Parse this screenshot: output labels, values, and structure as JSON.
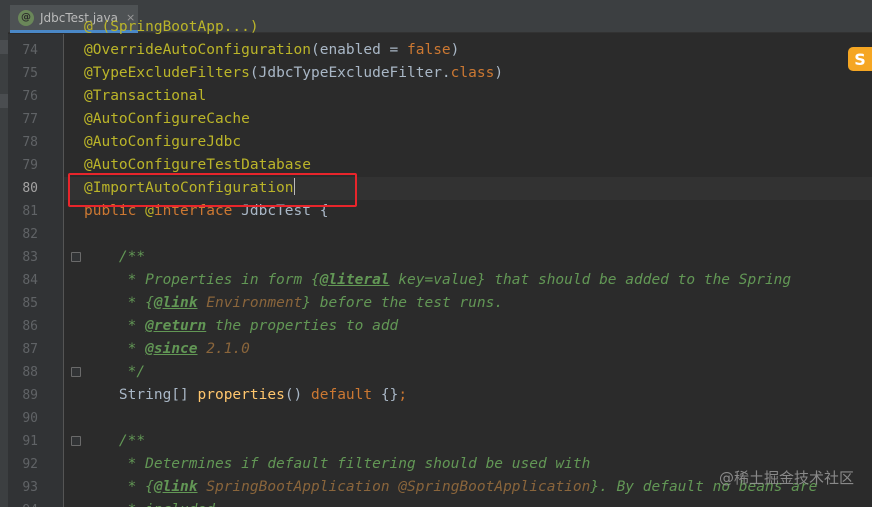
{
  "tab": {
    "icon_letter": "@",
    "label": "JdbcTest.java",
    "close": "×"
  },
  "top_partial": "@ (SpringBootApp...)",
  "lines": [
    {
      "n": "74",
      "tokens": [
        [
          "ann",
          "@OverrideAutoConfiguration"
        ],
        [
          "plain",
          "(enabled = "
        ],
        [
          "kw",
          "false"
        ],
        [
          "plain",
          ")"
        ]
      ]
    },
    {
      "n": "75",
      "tokens": [
        [
          "ann",
          "@TypeExcludeFilters"
        ],
        [
          "plain",
          "(JdbcTypeExcludeFilter."
        ],
        [
          "kw",
          "class"
        ],
        [
          "plain",
          ")"
        ]
      ]
    },
    {
      "n": "76",
      "tokens": [
        [
          "ann",
          "@Transactional"
        ]
      ]
    },
    {
      "n": "77",
      "tokens": [
        [
          "ann",
          "@AutoConfigureCache"
        ]
      ]
    },
    {
      "n": "78",
      "tokens": [
        [
          "ann",
          "@AutoConfigureJdbc"
        ]
      ]
    },
    {
      "n": "79",
      "tokens": [
        [
          "ann",
          "@AutoConfigureTestDatabase"
        ]
      ]
    },
    {
      "n": "80",
      "tokens": [
        [
          "ann",
          "@ImportAutoConfiguration"
        ]
      ],
      "current": true
    },
    {
      "n": "81",
      "tokens": [
        [
          "kw",
          "public "
        ],
        [
          "ann",
          "@"
        ],
        [
          "kw",
          "interface "
        ],
        [
          "plain",
          "JdbcTest {"
        ]
      ]
    },
    {
      "n": "82",
      "tokens": []
    },
    {
      "n": "83",
      "tokens": [
        [
          "plain",
          "    "
        ],
        [
          "doc",
          "/**"
        ]
      ],
      "fold": true
    },
    {
      "n": "84",
      "tokens": [
        [
          "plain",
          "     "
        ],
        [
          "doc",
          "* Properties in form {"
        ],
        [
          "doctag",
          "@literal"
        ],
        [
          "doc",
          " key=value} that should be added to the Spring"
        ]
      ]
    },
    {
      "n": "85",
      "tokens": [
        [
          "plain",
          "     "
        ],
        [
          "doc",
          "* {"
        ],
        [
          "doctag",
          "@link"
        ],
        [
          "docval",
          " Environment"
        ],
        [
          "doc",
          "} before the test runs."
        ]
      ]
    },
    {
      "n": "86",
      "tokens": [
        [
          "plain",
          "     "
        ],
        [
          "doc",
          "* "
        ],
        [
          "doctag",
          "@return"
        ],
        [
          "doc",
          " the properties to add"
        ]
      ]
    },
    {
      "n": "87",
      "tokens": [
        [
          "plain",
          "     "
        ],
        [
          "doc",
          "* "
        ],
        [
          "doctag",
          "@since"
        ],
        [
          "docval",
          " 2.1.0"
        ]
      ]
    },
    {
      "n": "88",
      "tokens": [
        [
          "plain",
          "     "
        ],
        [
          "doc",
          "*/"
        ]
      ],
      "fold": true
    },
    {
      "n": "89",
      "tokens": [
        [
          "plain",
          "    String[] "
        ],
        [
          "meth",
          "properties"
        ],
        [
          "plain",
          "() "
        ],
        [
          "kw",
          "default "
        ],
        [
          "plain",
          "{}"
        ],
        [
          "kw",
          ";"
        ]
      ]
    },
    {
      "n": "90",
      "tokens": []
    },
    {
      "n": "91",
      "tokens": [
        [
          "plain",
          "    "
        ],
        [
          "doc",
          "/**"
        ]
      ],
      "fold": true
    },
    {
      "n": "92",
      "tokens": [
        [
          "plain",
          "     "
        ],
        [
          "doc",
          "* Determines if default filtering should be used with"
        ]
      ]
    },
    {
      "n": "93",
      "tokens": [
        [
          "plain",
          "     "
        ],
        [
          "doc",
          "* {"
        ],
        [
          "doctag",
          "@link"
        ],
        [
          "docval",
          " SpringBootApplication"
        ],
        [
          "doc",
          " "
        ],
        [
          "docval",
          "@SpringBootApplication"
        ],
        [
          "doc",
          "}. By default no beans are"
        ]
      ]
    },
    {
      "n": "94",
      "tokens": [
        [
          "plain",
          "     "
        ],
        [
          "doc",
          "* included."
        ]
      ]
    }
  ],
  "ime_icon": "S",
  "watermark": "@稀土掘金技术社区"
}
